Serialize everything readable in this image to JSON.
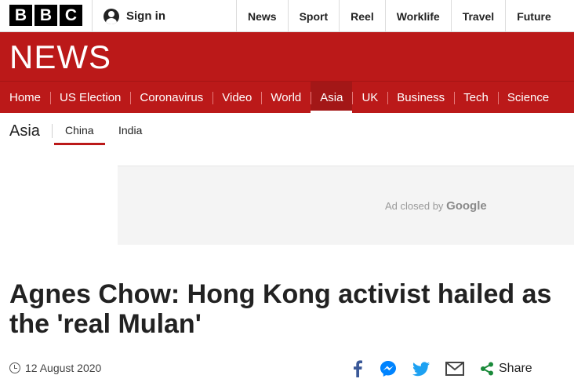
{
  "brand": {
    "letters": [
      "B",
      "B",
      "C"
    ],
    "wordmark": "NEWS",
    "accent": "#bb1919"
  },
  "topbar": {
    "signin_label": "Sign in",
    "links": [
      "News",
      "Sport",
      "Reel",
      "Worklife",
      "Travel",
      "Future"
    ]
  },
  "mainnav": {
    "items": [
      "Home",
      "US Election",
      "Coronavirus",
      "Video",
      "World",
      "Asia",
      "UK",
      "Business",
      "Tech",
      "Science"
    ],
    "active": "Asia"
  },
  "subnav": {
    "title": "Asia",
    "items": [
      "China",
      "India"
    ],
    "active": "China"
  },
  "ad": {
    "prefix": "Ad closed by",
    "provider": "Google"
  },
  "article": {
    "headline": "Agnes Chow: Hong Kong activist hailed as the 'real Mulan'",
    "date": "12 August 2020",
    "share_label": "Share",
    "share_icons": [
      "facebook-icon",
      "messenger-icon",
      "twitter-icon",
      "email-icon",
      "share-icon"
    ]
  }
}
